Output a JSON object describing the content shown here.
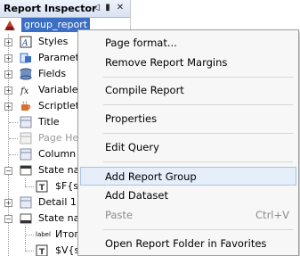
{
  "panel": {
    "title": "Report Inspector",
    "root": "group_report",
    "items": [
      {
        "label": "Styles",
        "icon": "styles-icon"
      },
      {
        "label": "Paramet",
        "icon": "parameters-icon"
      },
      {
        "label": "Fields",
        "icon": "fields-icon"
      },
      {
        "label": "Variables",
        "icon": "variables-icon"
      },
      {
        "label": "Scriptlet",
        "icon": "scriptlets-icon"
      },
      {
        "label": "Title",
        "icon": "band-icon"
      },
      {
        "label": "Page He",
        "icon": "band-icon"
      },
      {
        "label": "Column",
        "icon": "band-icon"
      },
      {
        "label": "State na",
        "icon": "group-header-icon"
      },
      {
        "label": "$F{s",
        "icon": "textfield-icon"
      },
      {
        "label": "Detail 1",
        "icon": "band-icon"
      },
      {
        "label": "State na",
        "icon": "group-footer-icon"
      },
      {
        "label": "Итог",
        "icon": "label-icon"
      },
      {
        "label": "$V{s",
        "icon": "textfield-icon"
      }
    ],
    "label_icon_text": "label"
  },
  "menu": {
    "items": [
      {
        "label": "Page format...",
        "shortcut": "",
        "disabled": false
      },
      {
        "label": "Remove Report Margins",
        "shortcut": "",
        "disabled": false
      },
      {
        "label": "Compile Report",
        "shortcut": "",
        "disabled": false
      },
      {
        "label": "Properties",
        "shortcut": "",
        "disabled": false
      },
      {
        "label": "Edit Query",
        "shortcut": "",
        "disabled": false
      },
      {
        "label": "Add Report Group",
        "shortcut": "",
        "disabled": false
      },
      {
        "label": "Add Dataset",
        "shortcut": "",
        "disabled": false
      },
      {
        "label": "Paste",
        "shortcut": "Ctrl+V",
        "disabled": true
      },
      {
        "label": "Open Report Folder in Favorites",
        "shortcut": "",
        "disabled": false
      }
    ]
  },
  "colors": {
    "selection": "#3b6fc4",
    "menu_hover": "#e5eef9",
    "title_bar": "#d7e2f2"
  }
}
